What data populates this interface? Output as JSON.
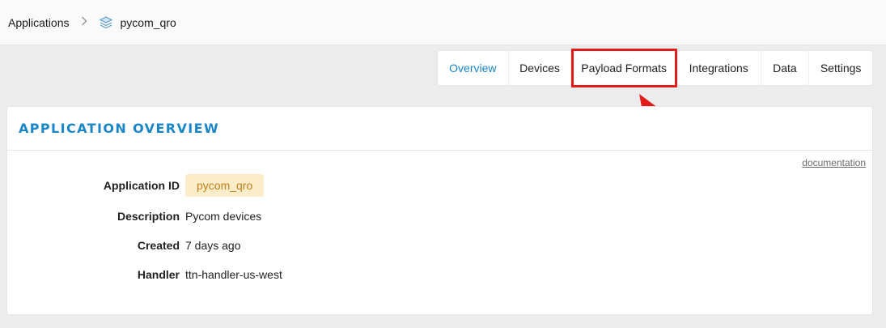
{
  "breadcrumb": {
    "root_label": "Applications",
    "separator": ">",
    "current_label": "pycom_qro",
    "current_icon": "stack-layers-icon"
  },
  "tabs": [
    {
      "label": "Overview",
      "active": true
    },
    {
      "label": "Devices",
      "active": false
    },
    {
      "label": "Payload Formats",
      "active": false,
      "highlighted": true
    },
    {
      "label": "Integrations",
      "active": false
    },
    {
      "label": "Data",
      "active": false
    },
    {
      "label": "Settings",
      "active": false
    }
  ],
  "overview": {
    "title": "APPLICATION OVERVIEW",
    "documentation_link": "documentation",
    "fields": {
      "application_id": {
        "label": "Application ID",
        "value": "pycom_qro"
      },
      "description": {
        "label": "Description",
        "value": "Pycom devices"
      },
      "created": {
        "label": "Created",
        "value": "7 days ago"
      },
      "handler": {
        "label": "Handler",
        "value": "ttn-handler-us-west"
      }
    }
  },
  "colors": {
    "accent": "#1a86c8",
    "annotation": "#e31b1b",
    "badge_bg": "#fdecc9",
    "badge_text": "#c0821a"
  }
}
